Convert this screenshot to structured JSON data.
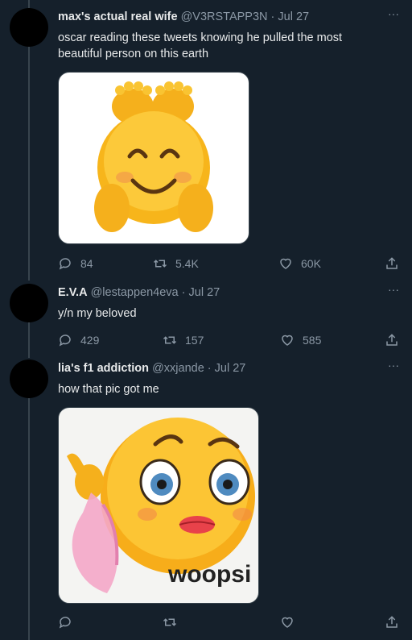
{
  "tweets": [
    {
      "name": "max's actual real wife",
      "handle": "@V3RSTAPP3N",
      "date": "Jul 27",
      "text": "oscar reading these tweets knowing he pulled the most beautiful person on this earth",
      "media": "smiling-emoji-holding-feet",
      "replies": "84",
      "retweets": "5.4K",
      "likes": "60K"
    },
    {
      "name": "E.V.A",
      "handle": "@lestappen4eva",
      "date": "Jul 27",
      "text": "y/n my beloved",
      "replies": "429",
      "retweets": "157",
      "likes": "585"
    },
    {
      "name": "lia's f1 addiction",
      "handle": "@xxjande",
      "date": "Jul 27",
      "text": "how that pic got me",
      "media_caption": "woopsi",
      "media": "flirty-emoji-holding-underwear",
      "replies": "",
      "retweets": "",
      "likes": ""
    }
  ],
  "more_icon": "more-horizontal-icon",
  "colors": {
    "background": "#15202b",
    "muted": "#8b98a5",
    "text": "#e7e9ea",
    "line": "#38444d"
  }
}
